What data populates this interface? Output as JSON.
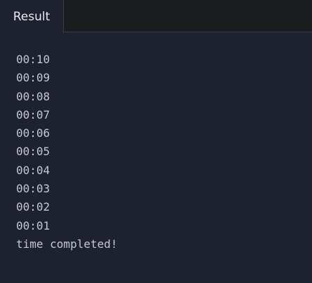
{
  "tabs": [
    {
      "label": "Result",
      "active": true
    }
  ],
  "console": {
    "lines": [
      "00:10",
      "00:09",
      "00:08",
      "00:07",
      "00:06",
      "00:05",
      "00:04",
      "00:03",
      "00:02",
      "00:01",
      "time completed!"
    ]
  },
  "colors": {
    "background": "#1d2130",
    "tabbar": "#1b1c1f",
    "text": "#c6c8cf",
    "tab_text": "#e9eaed",
    "border": "#3a3b40"
  }
}
